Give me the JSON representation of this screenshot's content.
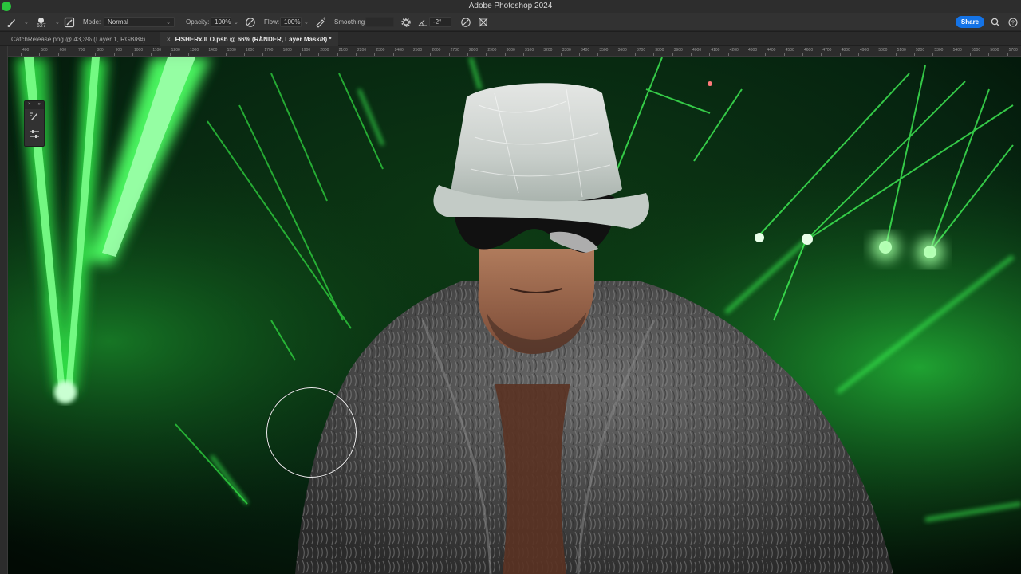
{
  "window": {
    "title": "Adobe Photoshop 2024"
  },
  "options_bar": {
    "brush_size": "627",
    "mode_label": "Mode:",
    "mode_value": "Normal",
    "opacity_label": "Opacity:",
    "opacity_value": "100%",
    "flow_label": "Flow:",
    "flow_value": "100%",
    "smoothing_label": "Smoothing:",
    "smoothing_value": "",
    "angle_value": "-2°",
    "share_label": "Share"
  },
  "tabs": [
    {
      "label": "CatchRelease.png @ 43,3% (Layer 1, RGB/8#)",
      "active": false
    },
    {
      "label": "FISHERxJLO.psb @ 66% (RÄNDER, Layer Mask/8) *",
      "active": true
    }
  ],
  "ruler": {
    "labels": [
      "400",
      "500",
      "600",
      "700",
      "800",
      "900",
      "1000",
      "1100",
      "1200",
      "1300",
      "1400",
      "1500",
      "1600",
      "1700",
      "1800",
      "1900",
      "2000",
      "2100",
      "2200",
      "2300",
      "2400",
      "2500",
      "2600",
      "2700",
      "2800",
      "2900",
      "3000",
      "3100",
      "3200",
      "3300",
      "3400",
      "3500",
      "3600",
      "3700",
      "3800",
      "3900",
      "4000",
      "4100",
      "4200",
      "4300",
      "4400",
      "4500",
      "4600",
      "4700",
      "4800",
      "4900",
      "5000",
      "5100",
      "5200",
      "5300",
      "5400",
      "5500",
      "5600",
      "5700"
    ]
  },
  "floating_panel": {
    "close_glyph": "×",
    "collapse_glyph": "»"
  },
  "colors": {
    "accent": "#1473e6",
    "laser_green": "#39ff4a",
    "background_dark": "#1e1e1e"
  }
}
